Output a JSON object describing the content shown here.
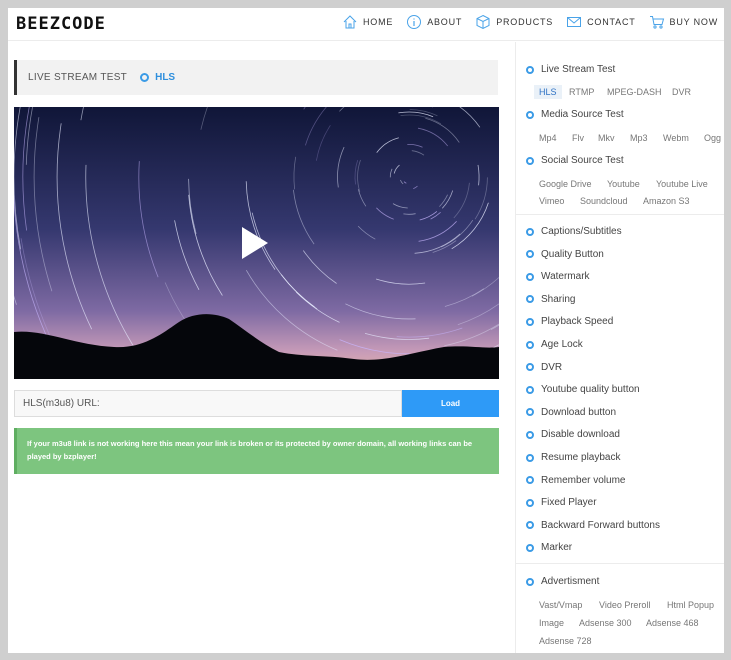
{
  "brand": "BEEZCODE",
  "nav": [
    {
      "icon": "home-icon",
      "label": "HOME"
    },
    {
      "icon": "info-icon",
      "label": "ABOUT"
    },
    {
      "icon": "box-icon",
      "label": "PRODUCTS"
    },
    {
      "icon": "envelope-icon",
      "label": "CONTACT"
    },
    {
      "icon": "cart-icon",
      "label": "BUY NOW"
    }
  ],
  "main": {
    "title": "LIVE STREAM TEST",
    "active_format": "HLS",
    "url_input": {
      "placeholder": "HLS(m3u8) URL:",
      "value": ""
    },
    "load_label": "Load",
    "notice_line1": "If your m3u8 link is not working here this mean your link is broken or its protected by owner domain, all working links can be",
    "notice_line2": "played by bzplayer!"
  },
  "sidebar": {
    "live_stream": {
      "title": "Live Stream Test",
      "items": [
        "HLS",
        "RTMP",
        "MPEG-DASH",
        "DVR"
      ]
    },
    "media_source": {
      "title": "Media Source Test",
      "items": [
        "Mp4",
        "Flv",
        "Mkv",
        "Mp3",
        "Webm",
        "Ogg"
      ]
    },
    "social_source": {
      "title": "Social Source Test",
      "items": [
        "Google Drive",
        "Youtube",
        "Youtube Live",
        "Vimeo",
        "Soundcloud",
        "Amazon S3"
      ]
    },
    "features": [
      "Captions/Subtitles",
      "Quality Button",
      "Watermark",
      "Sharing",
      "Playback Speed",
      "Age Lock",
      "DVR",
      "Youtube quality button",
      "Download button",
      "Disable download",
      "Resume playback",
      "Remember volume",
      "Fixed Player",
      "Backward Forward buttons",
      "Marker"
    ],
    "advertisment": {
      "title": "Advertisment",
      "items": [
        "Vast/Vmap",
        "Video Preroll",
        "Html Popup",
        "Image",
        "Adsense 300",
        "Adsense 468",
        "Adsense 728"
      ]
    }
  },
  "colors": {
    "accent": "#2e9af7",
    "notice": "#7dc57f",
    "ring": "#3b9be6"
  }
}
